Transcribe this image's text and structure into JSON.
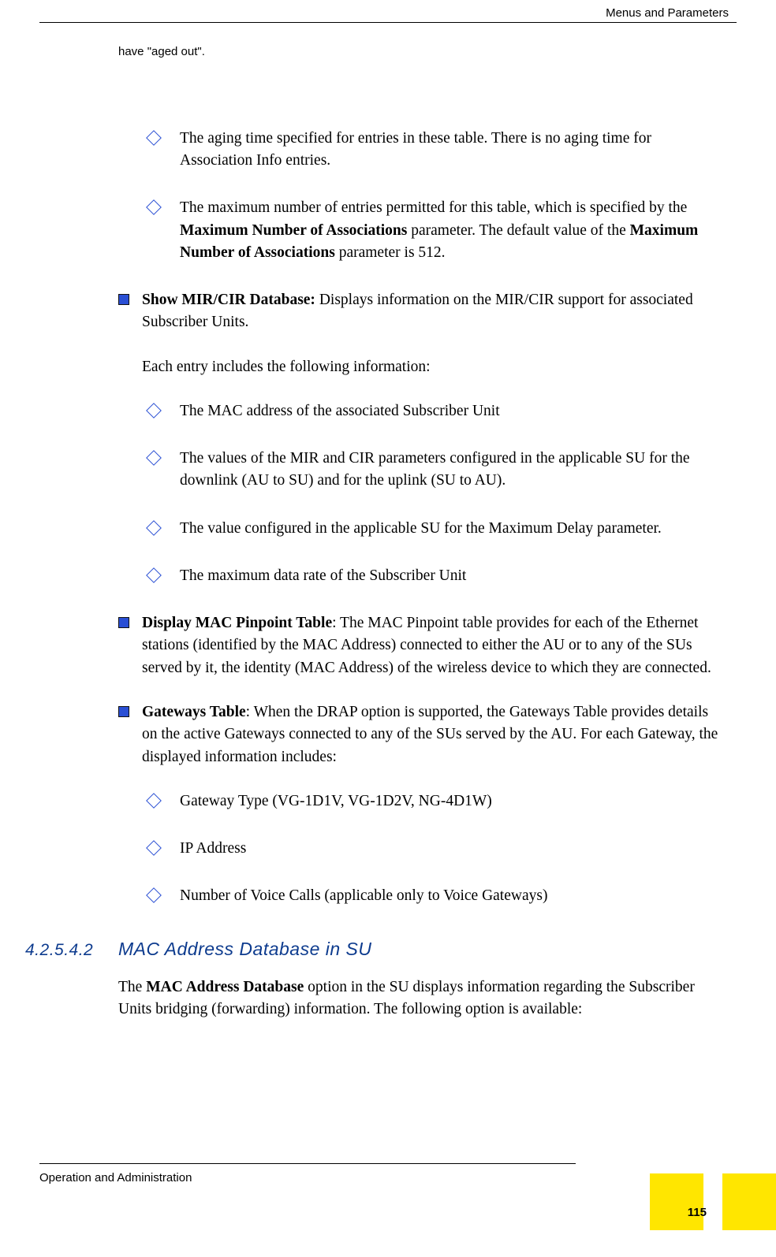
{
  "header": {
    "right": "Menus and Parameters"
  },
  "fragment": "have \"aged out\".",
  "d1": [
    "The aging time specified for entries in these table. There is no aging time for Association Info entries.",
    {
      "pre": "The maximum number of entries permitted for this table, which is specified by the ",
      "b1": "Maximum Number of Associations",
      "mid": " parameter. The default value of the ",
      "b2": "Maximum Number of Associations",
      "post": " parameter is 512."
    }
  ],
  "sq1": {
    "title": "Show MIR/CIR Database:",
    "rest": " Displays information on the MIR/CIR support for associated Subscriber Units."
  },
  "sq1_intro": "Each entry includes the following information:",
  "d2": [
    "The MAC address of the associated Subscriber Unit",
    "The values of the MIR and CIR parameters configured in the applicable SU for the downlink (AU to SU) and for the uplink (SU to AU).",
    "The value configured in the applicable SU for the Maximum Delay parameter.",
    "The maximum data rate of the Subscriber Unit"
  ],
  "sq2": {
    "title": "Display MAC Pinpoint Table",
    "rest": ": The MAC Pinpoint table provides for each of the Ethernet stations (identified by the MAC Address) connected to either the AU or to any of the SUs served by it, the identity (MAC Address) of the wireless device to which they are connected."
  },
  "sq3": {
    "title": "Gateways Table",
    "rest": ": When the DRAP option is supported, the Gateways Table provides details on the active Gateways connected to any of the SUs served by the AU. For each Gateway, the displayed information includes:"
  },
  "d3": [
    "Gateway Type (VG-1D1V, VG-1D2V, NG-4D1W)",
    "IP Address",
    "Number of Voice Calls (applicable only to Voice Gateways)"
  ],
  "section": {
    "num": "4.2.5.4.2",
    "title": "MAC Address Database in SU"
  },
  "section_para": {
    "pre": "The ",
    "b": "MAC Address Database",
    "post": " option in the SU displays information regarding the Subscriber Units bridging (forwarding) information. The following option is available:"
  },
  "footer": {
    "left": "Operation and Administration",
    "page": "115"
  }
}
